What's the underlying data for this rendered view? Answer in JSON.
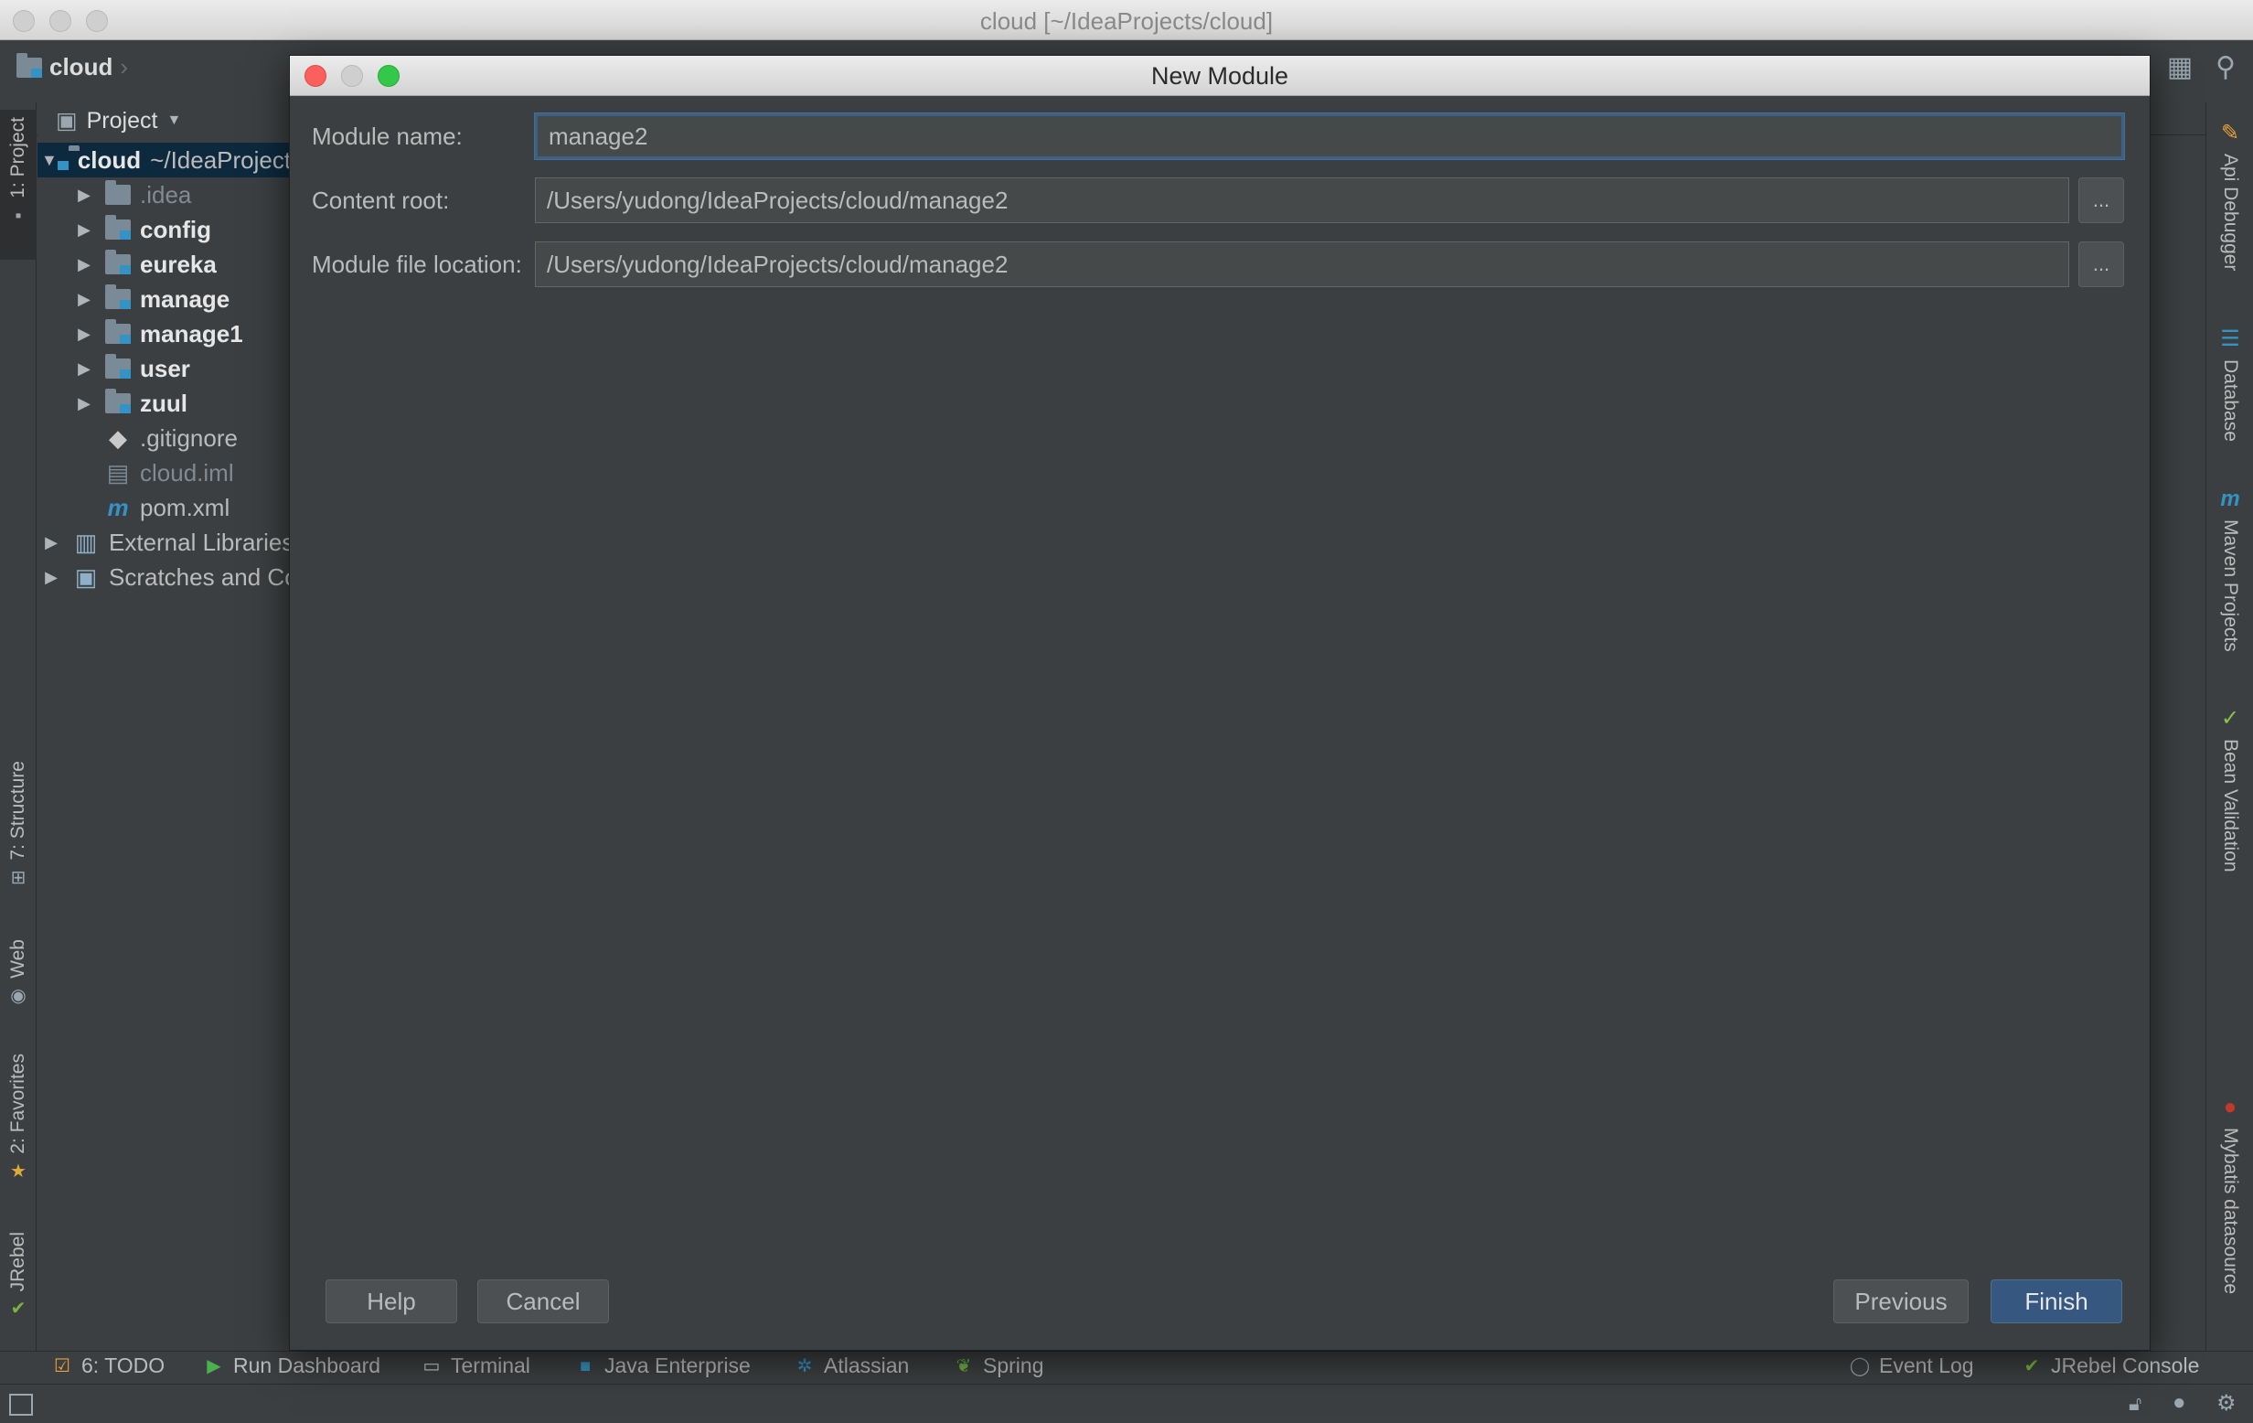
{
  "window": {
    "title": "cloud [~/IdeaProjects/cloud]"
  },
  "navbar": {
    "project_crumb": "cloud"
  },
  "left_stripe": {
    "tabs": [
      "1: Project",
      "7: Structure",
      "Web",
      "2: Favorites",
      "JRebel"
    ]
  },
  "project_panel": {
    "header": "Project",
    "tree": [
      {
        "label": "cloud",
        "suffix": "~/IdeaProjects/cloud"
      },
      {
        "label": ".idea"
      },
      {
        "label": "config"
      },
      {
        "label": "eureka"
      },
      {
        "label": "manage"
      },
      {
        "label": "manage1"
      },
      {
        "label": "user"
      },
      {
        "label": "zuul"
      },
      {
        "label": ".gitignore"
      },
      {
        "label": "cloud.iml"
      },
      {
        "label": "pom.xml"
      },
      {
        "label": "External Libraries"
      },
      {
        "label": "Scratches and Consoles"
      }
    ]
  },
  "right_stripe": {
    "tabs": [
      "Api Debugger",
      "Database",
      "Maven Projects",
      "Bean Validation",
      "Mybatis datasource"
    ]
  },
  "bottom_tabs": {
    "todo": "6: TODO",
    "run_dashboard": "Run Dashboard",
    "terminal": "Terminal",
    "java_enterprise": "Java Enterprise",
    "atlassian": "Atlassian",
    "spring": "Spring",
    "event_log": "Event Log",
    "jrebel_console": "JRebel Console"
  },
  "dialog": {
    "title": "New Module",
    "module_name_label": "Module name:",
    "module_name_value": "manage2",
    "content_root_label": "Content root:",
    "content_root_value": "/Users/yudong/IdeaProjects/cloud/manage2",
    "module_file_label": "Module file location:",
    "module_file_value": "/Users/yudong/IdeaProjects/cloud/manage2",
    "browse_label": "...",
    "help": "Help",
    "cancel": "Cancel",
    "previous": "Previous",
    "finish": "Finish"
  },
  "colors": {
    "background": "#3c3f41",
    "selection": "#0d293e",
    "primary_button": "#365880",
    "close_light": "#fc605c",
    "zoom_light": "#34c84a"
  }
}
